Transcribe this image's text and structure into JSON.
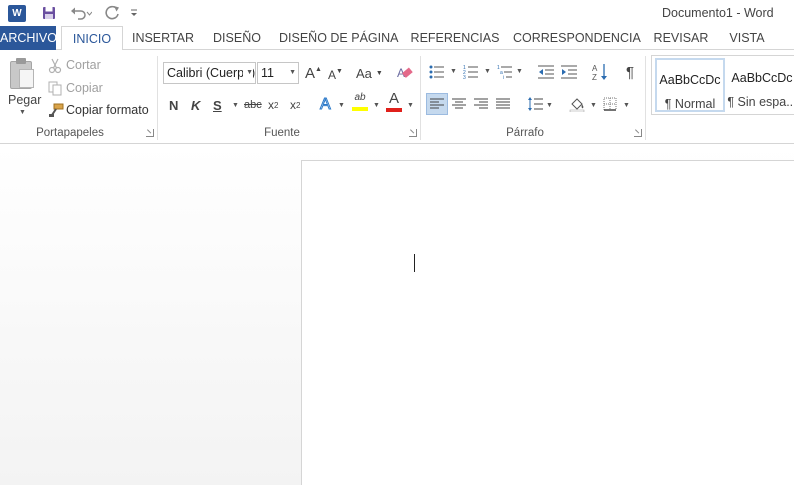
{
  "window": {
    "title": "Documento1 - Word",
    "app_icon": "W"
  },
  "qat": {
    "save": "save-icon",
    "undo": "undo-icon",
    "redo": "redo-icon",
    "customize": "customize-qat-icon"
  },
  "tabs": [
    {
      "label": "ARCHIVO"
    },
    {
      "label": "INICIO"
    },
    {
      "label": "INSERTAR"
    },
    {
      "label": "DISEÑO"
    },
    {
      "label": "DISEÑO DE PÁGINA"
    },
    {
      "label": "REFERENCIAS"
    },
    {
      "label": "CORRESPONDENCIA"
    },
    {
      "label": "REVISAR"
    },
    {
      "label": "VISTA"
    }
  ],
  "clipboard": {
    "group_label": "Portapapeles",
    "paste": "Pegar",
    "cut": "Cortar",
    "copy": "Copiar",
    "format_painter": "Copiar formato"
  },
  "font": {
    "group_label": "Fuente",
    "font_name": "Calibri (Cuerpo)",
    "font_size": "11",
    "grow": "A",
    "shrink": "A",
    "case": "Aa",
    "bold": "N",
    "italic": "K",
    "underline": "S",
    "strike": "abc",
    "subscript": "x",
    "subscript_mark": "2",
    "superscript": "x",
    "superscript_mark": "2",
    "text_effects": "A",
    "highlight": "ab",
    "font_color": "A",
    "highlight_color": "#ffff00",
    "font_color_value": "#e0201b"
  },
  "paragraph": {
    "group_label": "Párrafo",
    "pilcrow": "¶"
  },
  "styles": {
    "items": [
      {
        "sample": "AaBbCcDc",
        "name": "¶ Normal"
      },
      {
        "sample": "AaBbCcDc",
        "name": "¶ Sin espa..."
      }
    ]
  },
  "colors": {
    "accent": "#2b579a",
    "selected_bg": "#c5d9ee"
  }
}
